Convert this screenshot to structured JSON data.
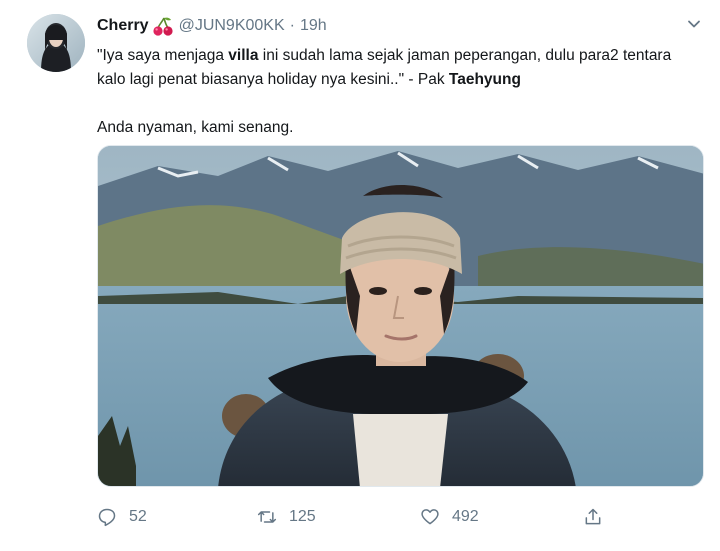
{
  "tweet": {
    "display_name": "Cherry",
    "handle": "@JUN9K00KK",
    "separator": "·",
    "time": "19h",
    "text_parts": [
      "\"Iya saya menjaga ",
      "villa",
      " ini sudah lama sejak jaman peperangan, dulu para2 tentara kalo lagi penat biasanya holiday nya kesini..\" - Pak ",
      "Taehyung"
    ],
    "second_line": "Anda nyaman, kami senang."
  },
  "actions": {
    "reply_count": "52",
    "retweet_count": "125",
    "like_count": "492"
  },
  "icons": {
    "name_emoji": "cherry-icon",
    "menu": "chevron-down-icon",
    "reply": "reply-icon",
    "retweet": "retweet-icon",
    "like": "heart-icon",
    "share": "share-icon"
  },
  "colors": {
    "text_primary": "#14171a",
    "text_secondary": "#657786",
    "cherry": "#e0245e"
  }
}
